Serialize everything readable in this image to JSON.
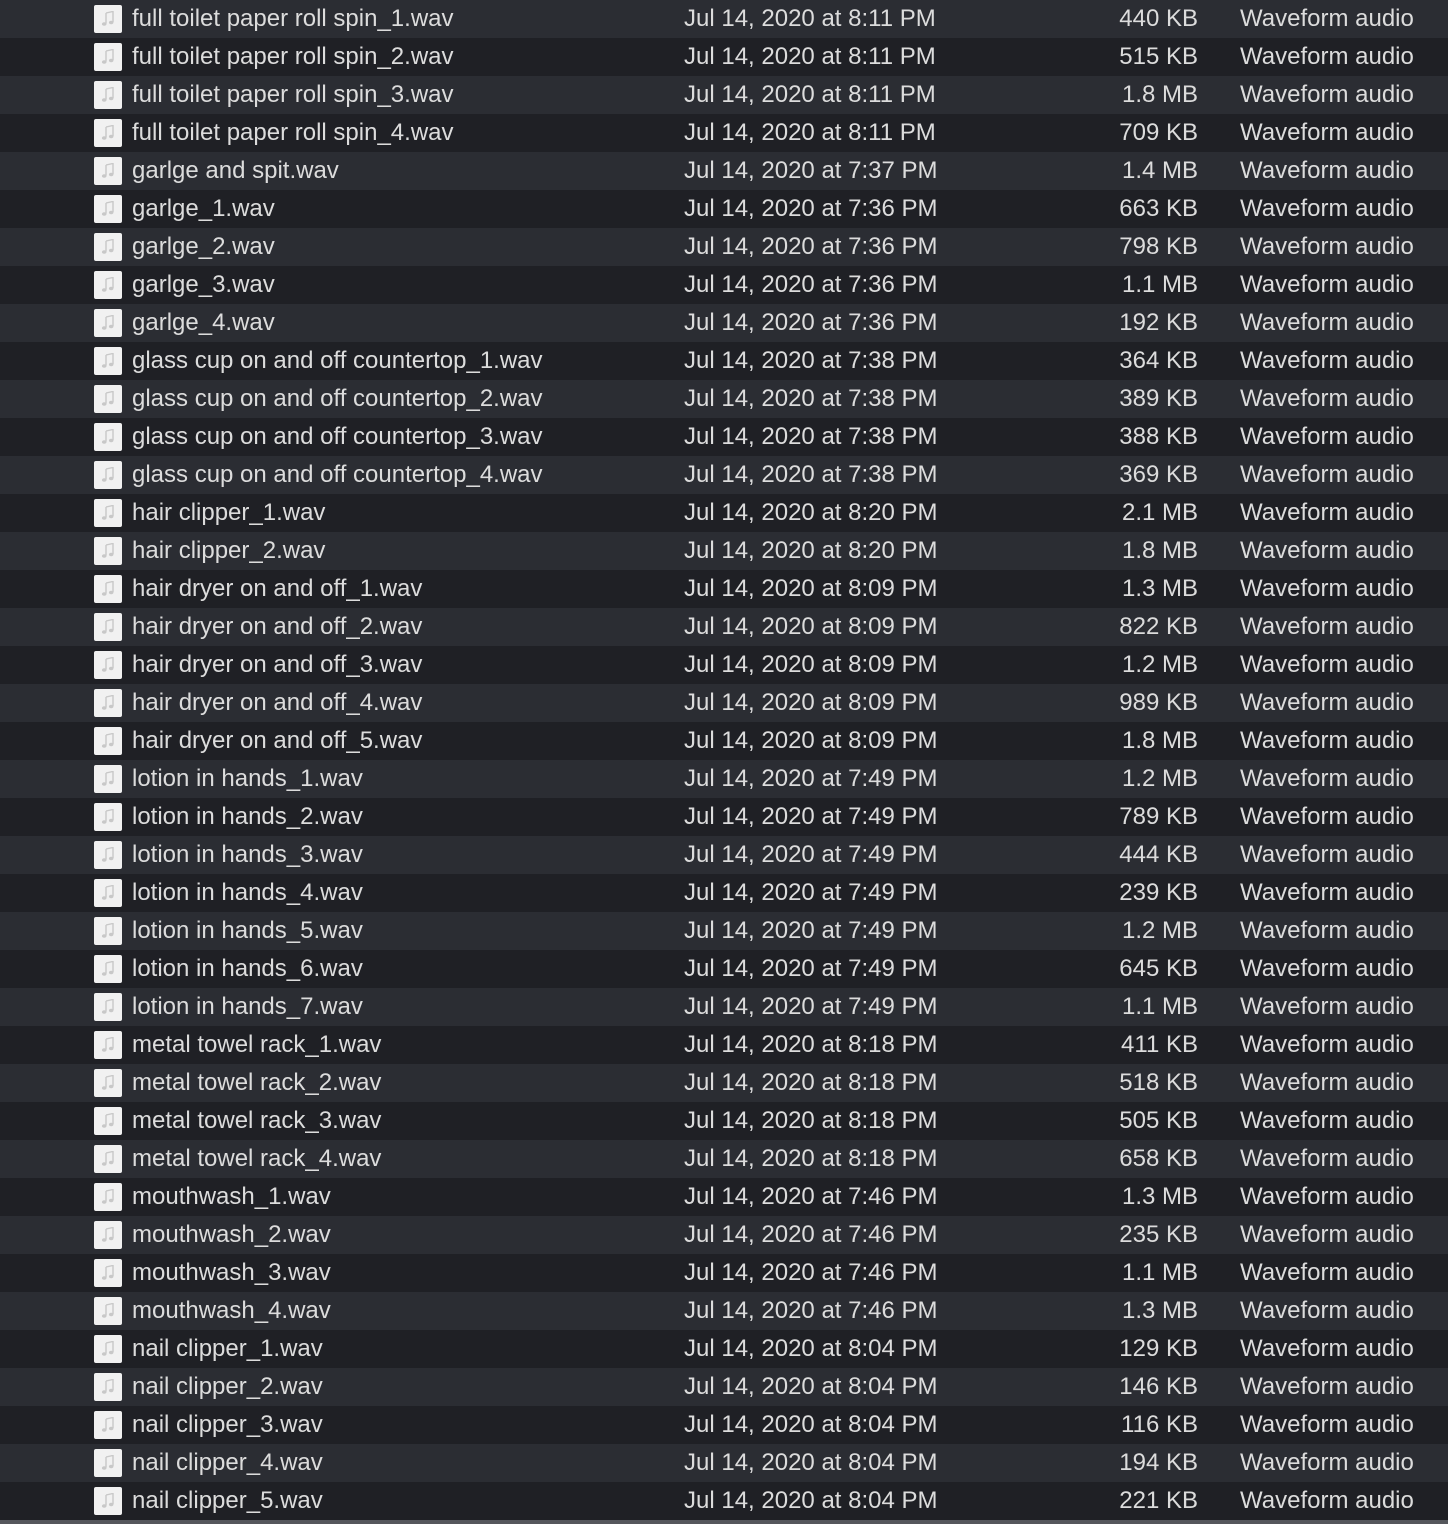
{
  "files": [
    {
      "name": "full toilet paper roll spin_1.wav",
      "date": "Jul 14, 2020 at 8:11 PM",
      "size": "440 KB",
      "kind": "Waveform audio"
    },
    {
      "name": "full toilet paper roll spin_2.wav",
      "date": "Jul 14, 2020 at 8:11 PM",
      "size": "515 KB",
      "kind": "Waveform audio"
    },
    {
      "name": "full toilet paper roll spin_3.wav",
      "date": "Jul 14, 2020 at 8:11 PM",
      "size": "1.8 MB",
      "kind": "Waveform audio"
    },
    {
      "name": "full toilet paper roll spin_4.wav",
      "date": "Jul 14, 2020 at 8:11 PM",
      "size": "709 KB",
      "kind": "Waveform audio"
    },
    {
      "name": "garlge and spit.wav",
      "date": "Jul 14, 2020 at 7:37 PM",
      "size": "1.4 MB",
      "kind": "Waveform audio"
    },
    {
      "name": "garlge_1.wav",
      "date": "Jul 14, 2020 at 7:36 PM",
      "size": "663 KB",
      "kind": "Waveform audio"
    },
    {
      "name": "garlge_2.wav",
      "date": "Jul 14, 2020 at 7:36 PM",
      "size": "798 KB",
      "kind": "Waveform audio"
    },
    {
      "name": "garlge_3.wav",
      "date": "Jul 14, 2020 at 7:36 PM",
      "size": "1.1 MB",
      "kind": "Waveform audio"
    },
    {
      "name": "garlge_4.wav",
      "date": "Jul 14, 2020 at 7:36 PM",
      "size": "192 KB",
      "kind": "Waveform audio"
    },
    {
      "name": "glass cup on and off countertop_1.wav",
      "date": "Jul 14, 2020 at 7:38 PM",
      "size": "364 KB",
      "kind": "Waveform audio"
    },
    {
      "name": "glass cup on and off countertop_2.wav",
      "date": "Jul 14, 2020 at 7:38 PM",
      "size": "389 KB",
      "kind": "Waveform audio"
    },
    {
      "name": "glass cup on and off countertop_3.wav",
      "date": "Jul 14, 2020 at 7:38 PM",
      "size": "388 KB",
      "kind": "Waveform audio"
    },
    {
      "name": "glass cup on and off countertop_4.wav",
      "date": "Jul 14, 2020 at 7:38 PM",
      "size": "369 KB",
      "kind": "Waveform audio"
    },
    {
      "name": "hair clipper_1.wav",
      "date": "Jul 14, 2020 at 8:20 PM",
      "size": "2.1 MB",
      "kind": "Waveform audio"
    },
    {
      "name": "hair clipper_2.wav",
      "date": "Jul 14, 2020 at 8:20 PM",
      "size": "1.8 MB",
      "kind": "Waveform audio"
    },
    {
      "name": "hair dryer on and off_1.wav",
      "date": "Jul 14, 2020 at 8:09 PM",
      "size": "1.3 MB",
      "kind": "Waveform audio"
    },
    {
      "name": "hair dryer on and off_2.wav",
      "date": "Jul 14, 2020 at 8:09 PM",
      "size": "822 KB",
      "kind": "Waveform audio"
    },
    {
      "name": "hair dryer on and off_3.wav",
      "date": "Jul 14, 2020 at 8:09 PM",
      "size": "1.2 MB",
      "kind": "Waveform audio"
    },
    {
      "name": "hair dryer on and off_4.wav",
      "date": "Jul 14, 2020 at 8:09 PM",
      "size": "989 KB",
      "kind": "Waveform audio"
    },
    {
      "name": "hair dryer on and off_5.wav",
      "date": "Jul 14, 2020 at 8:09 PM",
      "size": "1.8 MB",
      "kind": "Waveform audio"
    },
    {
      "name": "lotion in hands_1.wav",
      "date": "Jul 14, 2020 at 7:49 PM",
      "size": "1.2 MB",
      "kind": "Waveform audio"
    },
    {
      "name": "lotion in hands_2.wav",
      "date": "Jul 14, 2020 at 7:49 PM",
      "size": "789 KB",
      "kind": "Waveform audio"
    },
    {
      "name": "lotion in hands_3.wav",
      "date": "Jul 14, 2020 at 7:49 PM",
      "size": "444 KB",
      "kind": "Waveform audio"
    },
    {
      "name": "lotion in hands_4.wav",
      "date": "Jul 14, 2020 at 7:49 PM",
      "size": "239 KB",
      "kind": "Waveform audio"
    },
    {
      "name": "lotion in hands_5.wav",
      "date": "Jul 14, 2020 at 7:49 PM",
      "size": "1.2 MB",
      "kind": "Waveform audio"
    },
    {
      "name": "lotion in hands_6.wav",
      "date": "Jul 14, 2020 at 7:49 PM",
      "size": "645 KB",
      "kind": "Waveform audio"
    },
    {
      "name": "lotion in hands_7.wav",
      "date": "Jul 14, 2020 at 7:49 PM",
      "size": "1.1 MB",
      "kind": "Waveform audio"
    },
    {
      "name": "metal towel rack_1.wav",
      "date": "Jul 14, 2020 at 8:18 PM",
      "size": "411 KB",
      "kind": "Waveform audio"
    },
    {
      "name": "metal towel rack_2.wav",
      "date": "Jul 14, 2020 at 8:18 PM",
      "size": "518 KB",
      "kind": "Waveform audio"
    },
    {
      "name": "metal towel rack_3.wav",
      "date": "Jul 14, 2020 at 8:18 PM",
      "size": "505 KB",
      "kind": "Waveform audio"
    },
    {
      "name": "metal towel rack_4.wav",
      "date": "Jul 14, 2020 at 8:18 PM",
      "size": "658 KB",
      "kind": "Waveform audio"
    },
    {
      "name": "mouthwash_1.wav",
      "date": "Jul 14, 2020 at 7:46 PM",
      "size": "1.3 MB",
      "kind": "Waveform audio"
    },
    {
      "name": "mouthwash_2.wav",
      "date": "Jul 14, 2020 at 7:46 PM",
      "size": "235 KB",
      "kind": "Waveform audio"
    },
    {
      "name": "mouthwash_3.wav",
      "date": "Jul 14, 2020 at 7:46 PM",
      "size": "1.1 MB",
      "kind": "Waveform audio"
    },
    {
      "name": "mouthwash_4.wav",
      "date": "Jul 14, 2020 at 7:46 PM",
      "size": "1.3 MB",
      "kind": "Waveform audio"
    },
    {
      "name": "nail clipper_1.wav",
      "date": "Jul 14, 2020 at 8:04 PM",
      "size": "129 KB",
      "kind": "Waveform audio"
    },
    {
      "name": "nail clipper_2.wav",
      "date": "Jul 14, 2020 at 8:04 PM",
      "size": "146 KB",
      "kind": "Waveform audio"
    },
    {
      "name": "nail clipper_3.wav",
      "date": "Jul 14, 2020 at 8:04 PM",
      "size": "116 KB",
      "kind": "Waveform audio"
    },
    {
      "name": "nail clipper_4.wav",
      "date": "Jul 14, 2020 at 8:04 PM",
      "size": "194 KB",
      "kind": "Waveform audio"
    },
    {
      "name": "nail clipper_5.wav",
      "date": "Jul 14, 2020 at 8:04 PM",
      "size": "221 KB",
      "kind": "Waveform audio"
    }
  ],
  "file_icon": "audio-file-icon",
  "colors": {
    "row_even": "#2b2d33",
    "row_odd": "#1f2025",
    "text": "#dcdcdc",
    "icon_bg": "#f1f1f1"
  }
}
